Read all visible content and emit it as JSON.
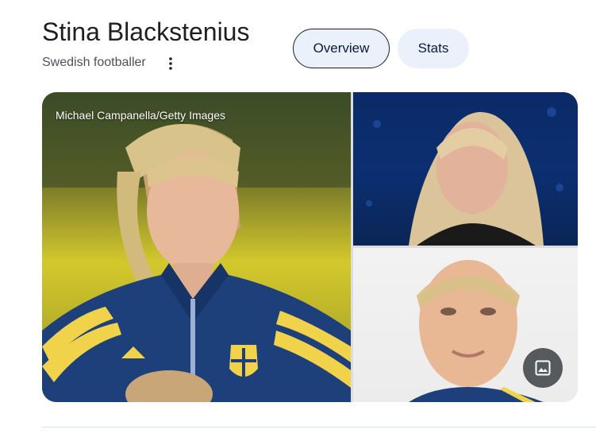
{
  "header": {
    "title": "Stina Blackstenius",
    "subtitle": "Swedish footballer"
  },
  "tabs": [
    {
      "label": "Overview",
      "selected": true
    },
    {
      "label": "Stats",
      "selected": false
    }
  ],
  "gallery": {
    "main_photo_credit": "Michael Campanella/Getty Images",
    "more_images_icon": "image-icon"
  },
  "colors": {
    "tab_background": "#eaf1fb",
    "jersey_blue": "#1d3f7a",
    "jersey_yellow": "#f0d34a"
  }
}
